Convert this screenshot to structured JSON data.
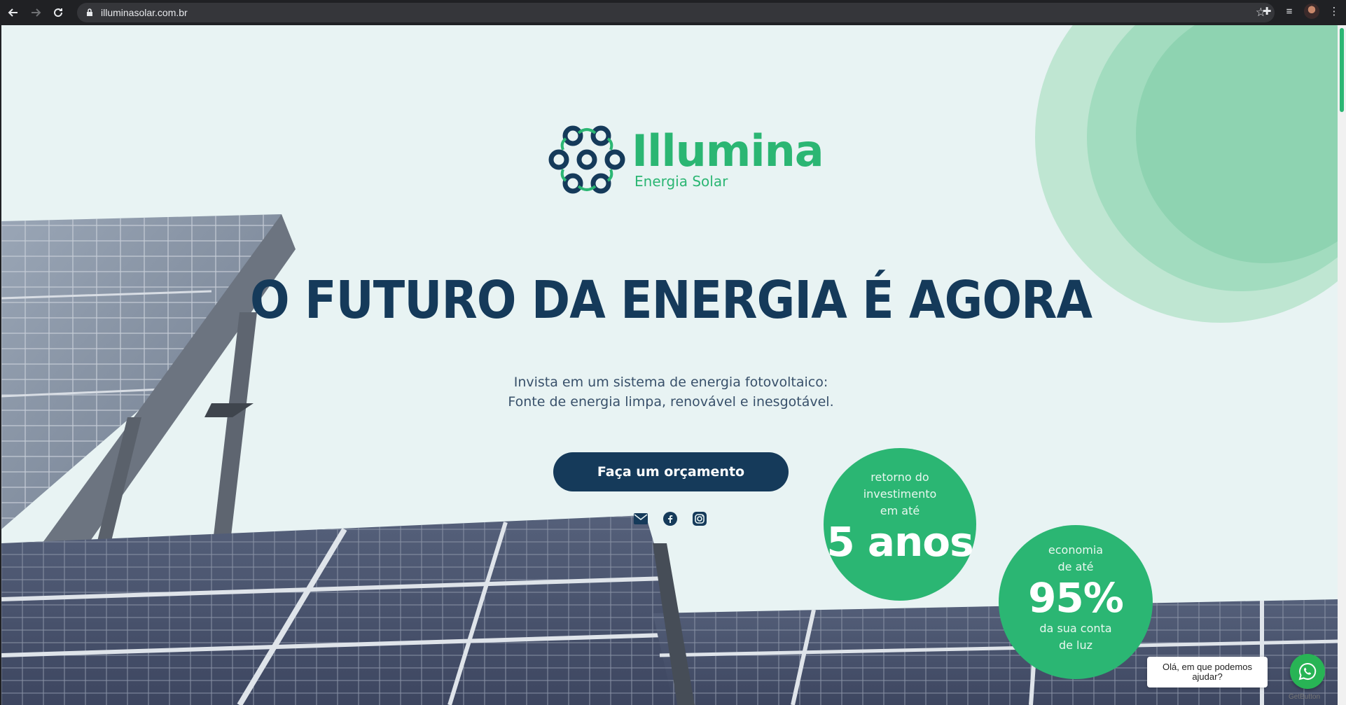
{
  "browser": {
    "url": "illuminasolar.com.br",
    "back_icon": "arrow-left-icon",
    "forward_icon": "arrow-right-icon",
    "reload_icon": "reload-icon"
  },
  "logo": {
    "brand": "Illumina",
    "tagline": "Energia Solar"
  },
  "hero": {
    "headline": "O FUTURO DA ENERGIA É AGORA",
    "subtitle_line1": "Invista em um sistema de energia fotovoltaico:",
    "subtitle_line2": "Fonte de energia limpa, renovável e inesgotável.",
    "cta_label": "Faça um orçamento"
  },
  "socials": [
    {
      "icon": "email-icon"
    },
    {
      "icon": "facebook-icon"
    },
    {
      "icon": "instagram-icon"
    }
  ],
  "badges": {
    "roi": {
      "line1": "retorno do",
      "line2": "investimento",
      "line3": "em até",
      "value": "5 anos"
    },
    "savings": {
      "line1": "economia",
      "line2": "de até",
      "value": "95%",
      "line3": "da sua conta",
      "line4": "de luz"
    }
  },
  "chat": {
    "bubble_line1": "Olá, em que podemos",
    "bubble_line2": "ajudar?",
    "credit": "GetButton"
  },
  "colors": {
    "primary_green": "#2bb673",
    "navy": "#153a5a",
    "background": "#e8f3f3"
  }
}
